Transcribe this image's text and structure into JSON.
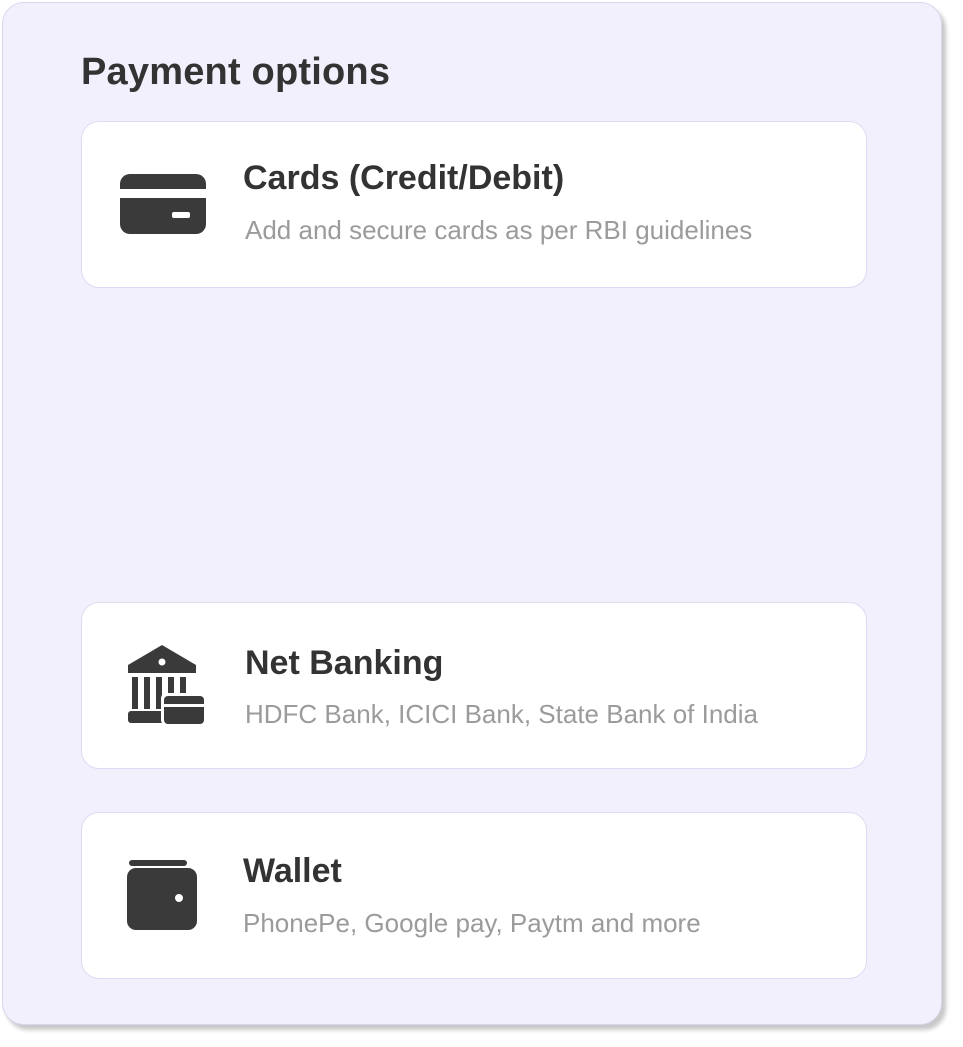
{
  "panel": {
    "title": "Payment options"
  },
  "options": [
    {
      "label": "Cards (Credit/Debit)",
      "description": "Add and secure cards as per RBI guidelines",
      "icon": "credit-card-icon"
    },
    {
      "label": "Net Banking",
      "description": "HDFC Bank, ICICI Bank, State Bank of India",
      "icon": "bank-icon"
    },
    {
      "label": "Wallet",
      "description": "PhonePe, Google pay, Paytm and more",
      "icon": "wallet-icon"
    }
  ],
  "colors": {
    "panel_background": "#f2f0fd",
    "card_background": "#ffffff",
    "card_border": "#dedaf3",
    "title_text": "#333333",
    "description_text": "#9b9b9b",
    "icon_fill": "#3a3a3a"
  }
}
